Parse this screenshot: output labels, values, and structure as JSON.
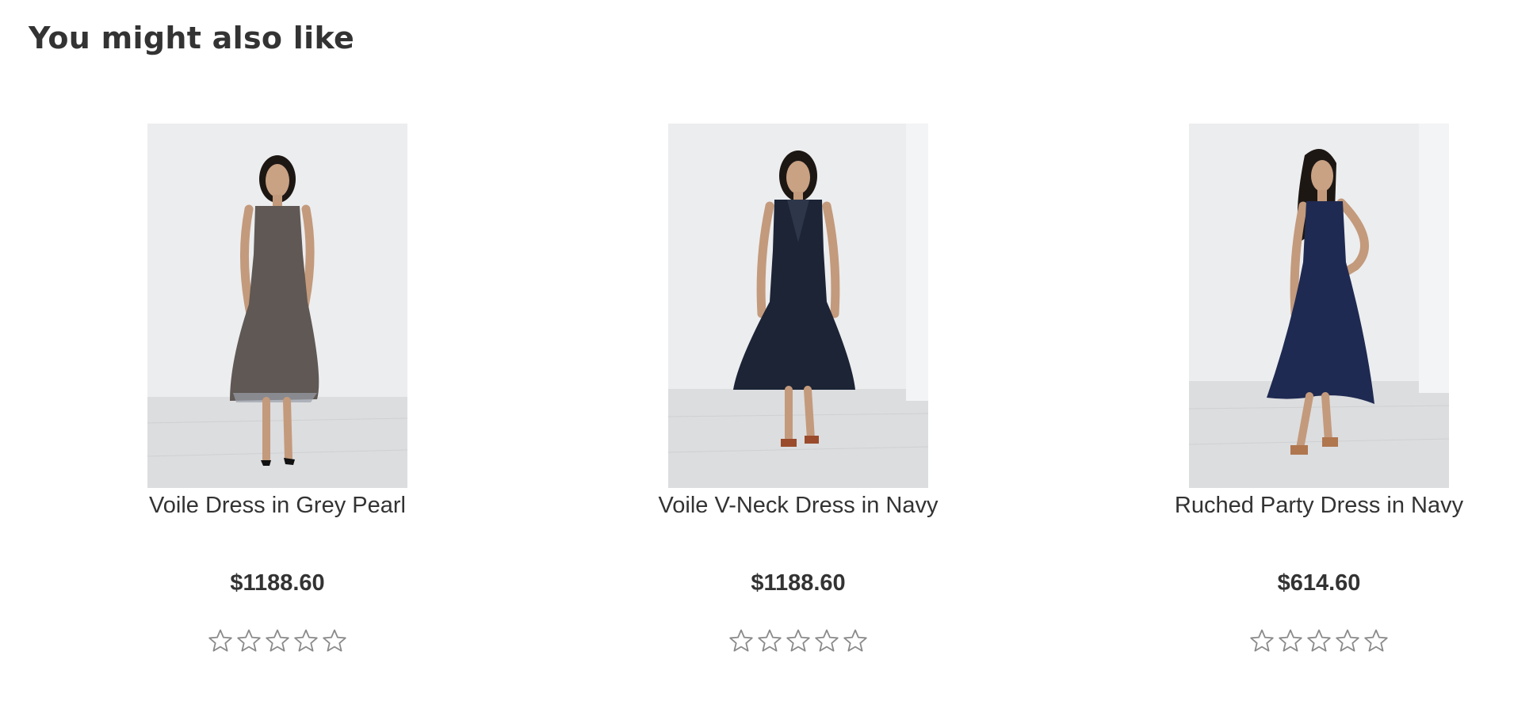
{
  "section": {
    "title": "You might also like"
  },
  "products": [
    {
      "name": "Voile Dress in Grey Pearl",
      "price": "$1188.60",
      "rating": 0,
      "rating_max": 5,
      "image_icon": "product-photo",
      "dress_color": "#5f5854"
    },
    {
      "name": "Voile V-Neck Dress in Navy",
      "price": "$1188.60",
      "rating": 0,
      "rating_max": 5,
      "image_icon": "product-photo",
      "dress_color": "#1c2436"
    },
    {
      "name": "Ruched Party Dress in Navy",
      "price": "$614.60",
      "rating": 0,
      "rating_max": 5,
      "image_icon": "product-photo",
      "dress_color": "#1f2a52"
    }
  ],
  "colors": {
    "text": "#333333",
    "star_outline": "#8a8a8a",
    "image_background": "#e9ebed",
    "floor": "#dcdddf"
  }
}
